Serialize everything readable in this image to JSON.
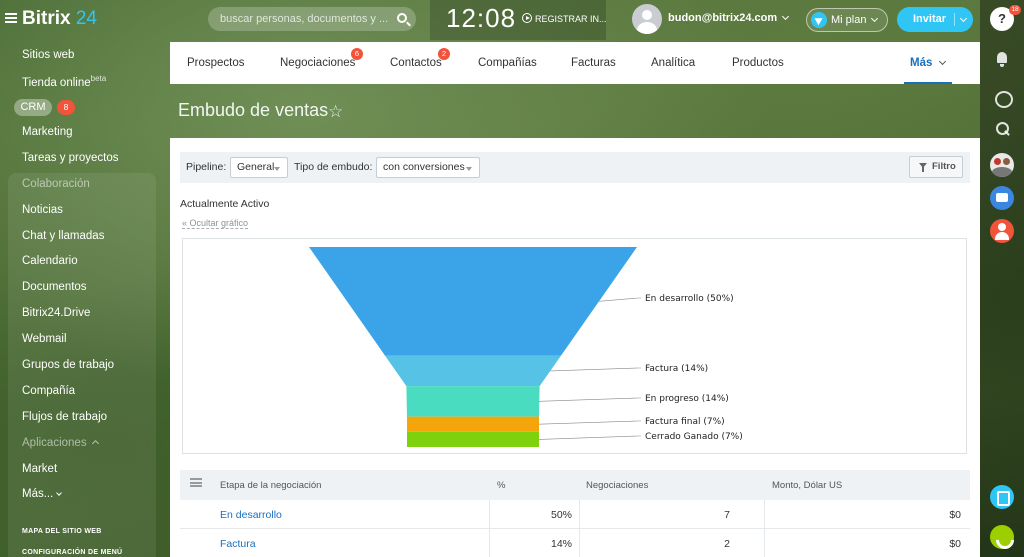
{
  "app": {
    "name": "Bitrix",
    "name_num": "24"
  },
  "header": {
    "search_placeholder": "buscar personas, documentos y ...",
    "clock": "12:08",
    "register_label": "REGISTRAR IN...",
    "username": "budon@bitrix24.com",
    "plan_label": "Mi plan",
    "invite_label": "Invitar",
    "help_badge": "18"
  },
  "sidebar": {
    "items": [
      {
        "label": "Sitios web"
      },
      {
        "label": "Tienda online",
        "sup": "beta"
      },
      {
        "label": "CRM",
        "badge": "8"
      },
      {
        "label": "Marketing"
      },
      {
        "label": "Tareas y proyectos"
      },
      {
        "label": "Colaboración"
      },
      {
        "label": "Noticias"
      },
      {
        "label": "Chat y llamadas"
      },
      {
        "label": "Calendario"
      },
      {
        "label": "Documentos"
      },
      {
        "label": "Bitrix24.Drive"
      },
      {
        "label": "Webmail"
      },
      {
        "label": "Grupos de trabajo"
      },
      {
        "label": "Compañía"
      },
      {
        "label": "Flujos de trabajo"
      },
      {
        "label": "Aplicaciones"
      },
      {
        "label": "Market"
      },
      {
        "label": "Más..."
      }
    ],
    "footer": [
      "MAPA DEL SITIO WEB",
      "CONFIGURACIÓN DE MENÚ"
    ]
  },
  "tabs": [
    {
      "label": "Prospectos"
    },
    {
      "label": "Negociaciones",
      "badge": "6"
    },
    {
      "label": "Contactos",
      "badge": "2"
    },
    {
      "label": "Compañías"
    },
    {
      "label": "Facturas"
    },
    {
      "label": "Analítica"
    },
    {
      "label": "Productos"
    },
    {
      "label": "Más"
    }
  ],
  "page": {
    "title": "Embudo de ventas"
  },
  "filters": {
    "pipeline_label": "Pipeline:",
    "pipeline_value": "General",
    "funnel_type_label": "Tipo de embudo:",
    "funnel_type_value": "con conversiones",
    "filter_button": "Filtro"
  },
  "section": {
    "title": "Actualmente Activo",
    "hide_chart": "Ocultar gráfico"
  },
  "chart_data": {
    "type": "funnel",
    "stages": [
      {
        "label": "En desarrollo (50%)",
        "value": 50,
        "color": "#3ba3e8"
      },
      {
        "label": "Factura (14%)",
        "value": 14,
        "color": "#56c2e6"
      },
      {
        "label": "En progreso (14%)",
        "value": 14,
        "color": "#49dcc0"
      },
      {
        "label": "Factura final (7%)",
        "value": 7,
        "color": "#f5a50c"
      },
      {
        "label": "Cerrado Ganado (7%)",
        "value": 7,
        "color": "#7dd10d"
      }
    ]
  },
  "table": {
    "headers": [
      "Etapa de la negociación",
      "%",
      "Negociaciones",
      "Monto, Dólar US"
    ],
    "rows": [
      {
        "stage": "En desarrollo",
        "percent": "50%",
        "deals": "7",
        "amount": "$0"
      },
      {
        "stage": "Factura",
        "percent": "14%",
        "deals": "2",
        "amount": "$0"
      }
    ]
  }
}
